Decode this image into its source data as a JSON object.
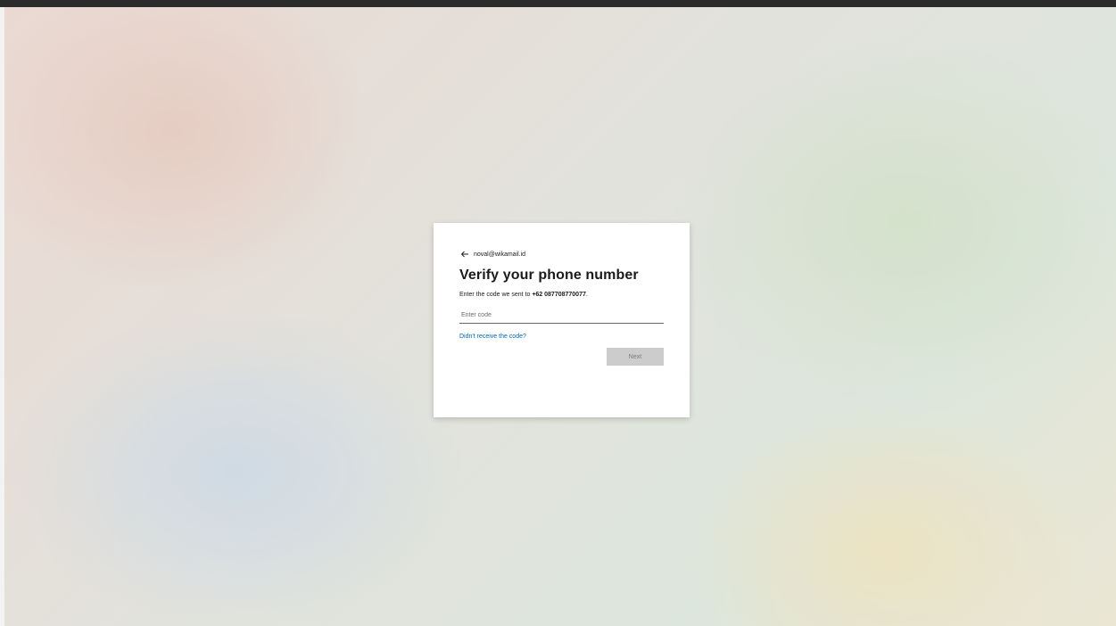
{
  "signin": {
    "identity": "noval@wikamail.id",
    "back_icon": "arrow-left-icon",
    "title": "Verify your phone number",
    "description_prefix": "Enter the code we sent to ",
    "phone_number": "+62 087708770077",
    "description_suffix": ".",
    "code_input": {
      "value": "",
      "placeholder": "Enter code"
    },
    "resend_link": "Didn't receive the code?",
    "next_label": "Next"
  },
  "colors": {
    "top_bar": "#2b2b2b",
    "link": "#0067b8",
    "button_disabled_bg": "#cccccc",
    "button_disabled_text": "#7a7a7a",
    "card_bg": "#ffffff"
  }
}
